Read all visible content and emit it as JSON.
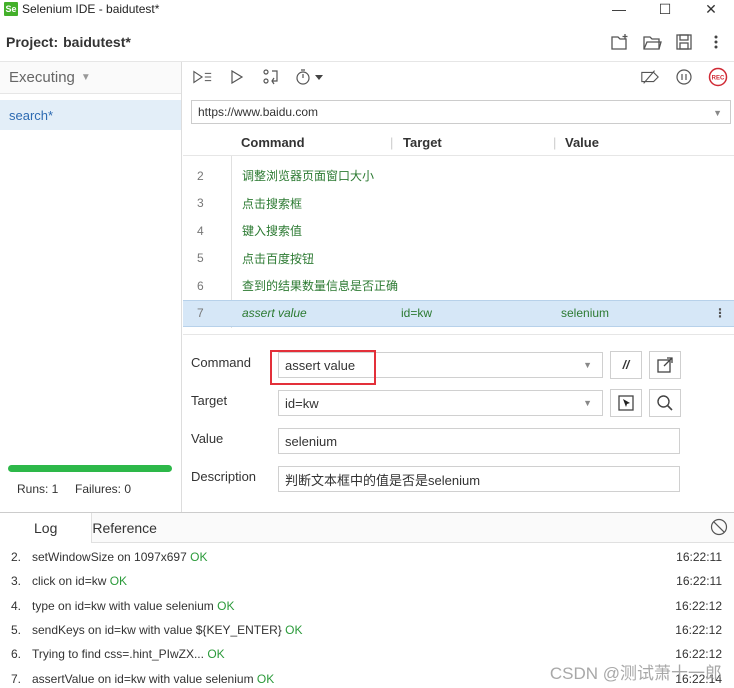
{
  "window": {
    "title": "Selenium IDE - baidutest*",
    "app_icon": "Se",
    "controls": [
      "—",
      "☐",
      "✕"
    ]
  },
  "project": {
    "label": "Project:",
    "name": "baidutest*"
  },
  "left": {
    "mode": "Executing",
    "tests": [
      {
        "label": "search*"
      }
    ],
    "runs_label": "Runs: 1",
    "failures_label": "Failures: 0",
    "progress": 1.0
  },
  "url": {
    "value": "https://www.baidu.com"
  },
  "table": {
    "headers": {
      "command": "Command",
      "target": "Target",
      "value": "Value"
    },
    "rows": [
      {
        "num": "2",
        "command": "调整浏览器页面窗口大小",
        "target": "",
        "value": ""
      },
      {
        "num": "3",
        "command": "点击搜索框",
        "target": "",
        "value": ""
      },
      {
        "num": "4",
        "command": "键入搜索值",
        "target": "",
        "value": ""
      },
      {
        "num": "5",
        "command": "点击百度按钮",
        "target": "",
        "value": ""
      },
      {
        "num": "6",
        "command": "查到的结果数量信息是否正确",
        "target": "",
        "value": ""
      },
      {
        "num": "7",
        "command": "assert value",
        "target": "id=kw",
        "value": "selenium"
      }
    ]
  },
  "details": {
    "command_label": "Command",
    "command_value": "assert value",
    "target_label": "Target",
    "target_value": "id=kw",
    "value_label": "Value",
    "value_value": "selenium",
    "description_label": "Description",
    "description_value": "判断文本框中的值是否是selenium",
    "comment_btn": "//"
  },
  "log": {
    "tabs": [
      "Log",
      "Reference"
    ],
    "lines": [
      {
        "num": "2.",
        "msg": "setWindowSize on 1097x697",
        "status": "OK",
        "time": "16:22:11"
      },
      {
        "num": "3.",
        "msg": "click on id=kw",
        "status": "OK",
        "time": "16:22:11"
      },
      {
        "num": "4.",
        "msg": "type on id=kw with value selenium",
        "status": "OK",
        "time": "16:22:12"
      },
      {
        "num": "5.",
        "msg": "sendKeys on id=kw with value ${KEY_ENTER}",
        "status": "OK",
        "time": "16:22:12"
      },
      {
        "num": "6.",
        "msg": "Trying to find css=.hint_PIwZX...",
        "status": "OK",
        "time": "16:22:12"
      },
      {
        "num": "7.",
        "msg": "assertValue on id=kw with value selenium",
        "status": "OK",
        "time": "16:22:14"
      }
    ],
    "watermark": "CSDN @测试萧十一郎"
  }
}
